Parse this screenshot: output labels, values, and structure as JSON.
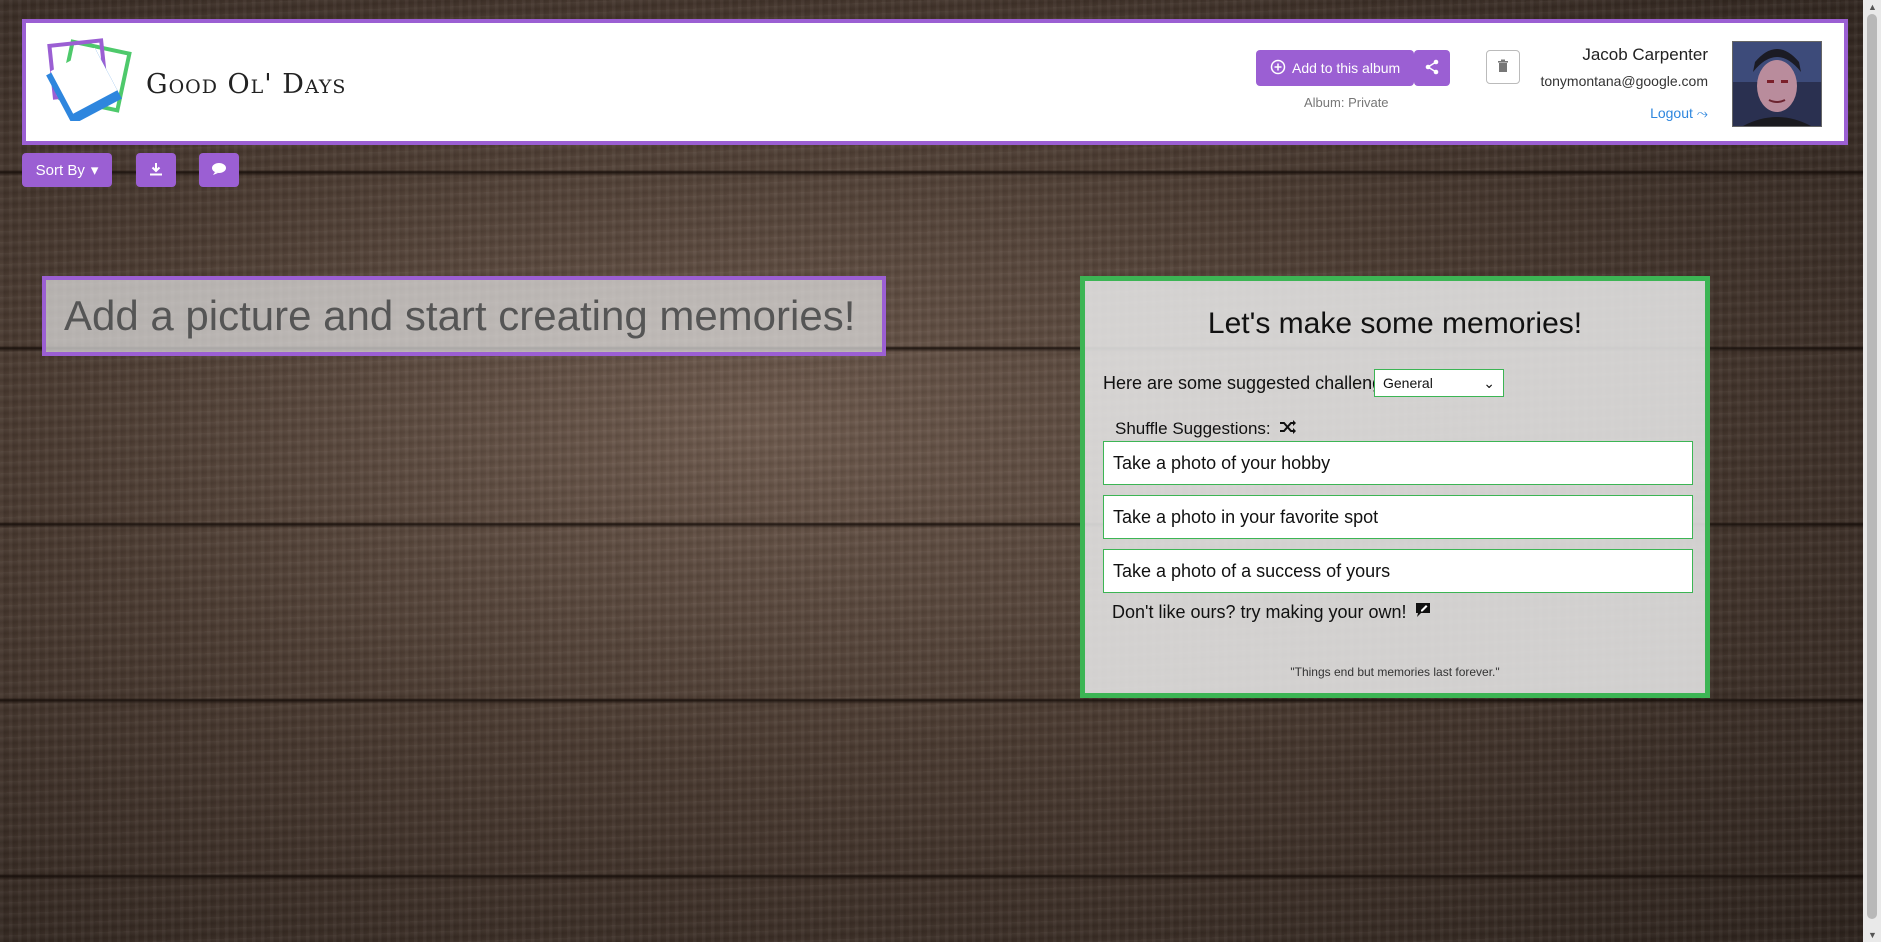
{
  "brand": {
    "name": "Good Ol' Days"
  },
  "header": {
    "add_album_label": "Add to this album",
    "album_status": "Album: Private",
    "user_name": "Jacob Carpenter",
    "user_email": "tonymontana@google.com",
    "logout_label": "Logout"
  },
  "toolbar": {
    "sort_label": "Sort By"
  },
  "main": {
    "empty_message": "Add a picture and start creating memories!"
  },
  "challenges": {
    "title": "Let's make some memories!",
    "suggested_label": "Here are some suggested challenges:",
    "category_selected": "General",
    "shuffle_label": "Shuffle Suggestions:",
    "suggestions": [
      "Take a photo of your hobby",
      "Take a photo in your favorite spot",
      "Take a photo of a success of yours"
    ],
    "own_label": "Don't like ours? try making your own!",
    "quote": "\"Things end but memories last forever.\""
  },
  "colors": {
    "accent": "#9b5fd3",
    "success": "#3cb554",
    "link": "#2e86de"
  }
}
